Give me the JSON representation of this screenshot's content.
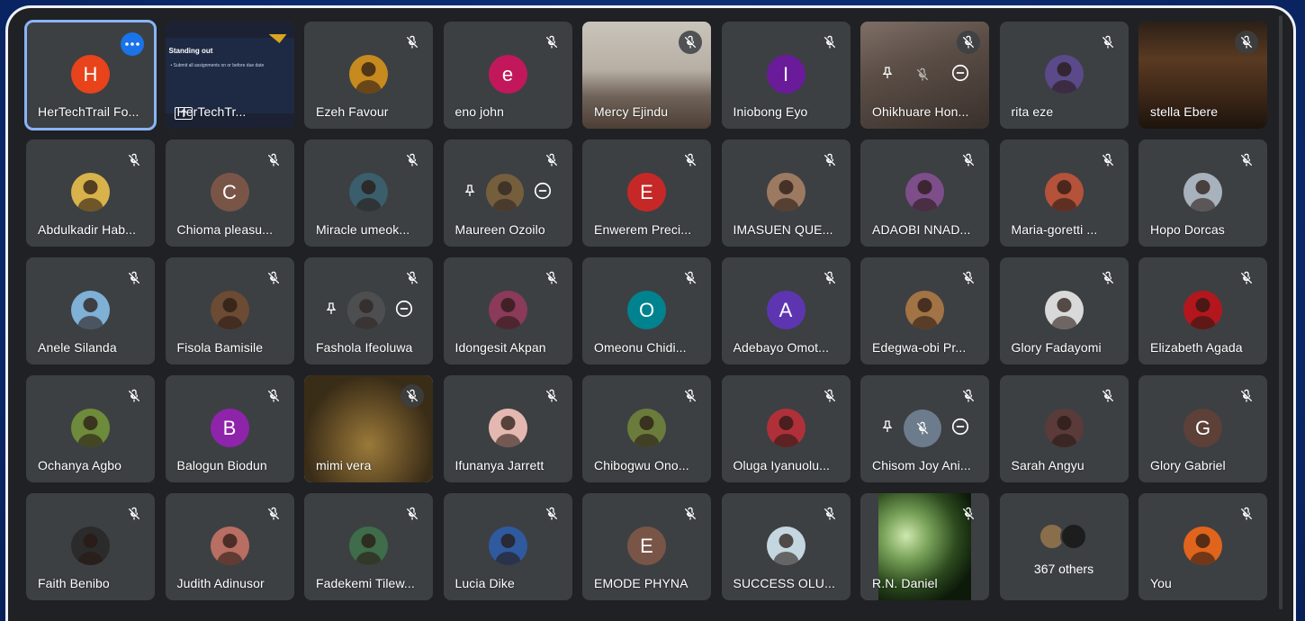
{
  "participants": [
    {
      "name": "HerTechTrail Fo...",
      "avatar": "letter",
      "letter": "H",
      "color": "#e8431b",
      "active": true,
      "control": "more"
    },
    {
      "name": "HerTechTr...",
      "avatar": "slide",
      "slide_title": "Standing out",
      "slide_bullet": "• Submit all assignments on or before due date",
      "control": "present"
    },
    {
      "name": "Ezeh Favour",
      "avatar": "photo",
      "color": "#c78a1e"
    },
    {
      "name": "eno john",
      "avatar": "letter",
      "letter": "e",
      "color": "#c2185b"
    },
    {
      "name": "Mercy Ejindu",
      "avatar": "video",
      "video": "vid-mercy"
    },
    {
      "name": "Iniobong Eyo",
      "avatar": "letter",
      "letter": "I",
      "color": "#6a1b9a"
    },
    {
      "name": "Ohikhuare Hon...",
      "avatar": "video-pinned",
      "video": "vid-ohik"
    },
    {
      "name": "rita eze",
      "avatar": "photo",
      "color": "#5a4a8a"
    },
    {
      "name": "stella Ebere",
      "avatar": "video",
      "video": "vid-stella"
    },
    {
      "name": "Abdulkadir Hab...",
      "avatar": "photo",
      "color": "#d8b24a"
    },
    {
      "name": "Chioma pleasu...",
      "avatar": "letter",
      "letter": "C",
      "color": "#795548"
    },
    {
      "name": "Miracle umeok...",
      "avatar": "photo",
      "color": "#3b5e6c"
    },
    {
      "name": "Maureen Ozoilo",
      "avatar": "pinned",
      "color": "#8e6b3a"
    },
    {
      "name": "Enwerem Preci...",
      "avatar": "letter",
      "letter": "E",
      "color": "#c62828"
    },
    {
      "name": "IMASUEN QUE...",
      "avatar": "photo",
      "color": "#9c7a62"
    },
    {
      "name": "ADAOBI NNAD...",
      "avatar": "photo",
      "color": "#7d4e8a"
    },
    {
      "name": "Maria-goretti ...",
      "avatar": "photo",
      "color": "#b5523a"
    },
    {
      "name": "Hopo Dorcas",
      "avatar": "photo",
      "color": "#a7b2bc"
    },
    {
      "name": "Anele Silanda",
      "avatar": "photo",
      "color": "#7fb0d6"
    },
    {
      "name": "Fisola Bamisile",
      "avatar": "photo",
      "color": "#6b4b33"
    },
    {
      "name": "Fashola Ifeoluwa",
      "avatar": "pinned",
      "color": "#555"
    },
    {
      "name": "Idongesit Akpan",
      "avatar": "photo",
      "color": "#8b3a5a"
    },
    {
      "name": "Omeonu Chidi...",
      "avatar": "letter",
      "letter": "O",
      "color": "#00838f"
    },
    {
      "name": "Adebayo Omot...",
      "avatar": "letter",
      "letter": "A",
      "color": "#5e35b1"
    },
    {
      "name": "Edegwa-obi Pr...",
      "avatar": "photo",
      "color": "#a27344"
    },
    {
      "name": "Glory Fadayomi",
      "avatar": "photo",
      "color": "#d9d9d9"
    },
    {
      "name": "Elizabeth Agada",
      "avatar": "photo",
      "color": "#b3171d"
    },
    {
      "name": "Ochanya Agbo",
      "avatar": "photo",
      "color": "#6d8b3a"
    },
    {
      "name": "Balogun Biodun",
      "avatar": "letter",
      "letter": "B",
      "color": "#8e24aa"
    },
    {
      "name": "mimi vera",
      "avatar": "video",
      "video": "vid-mimi"
    },
    {
      "name": "Ifunanya Jarrett",
      "avatar": "photo",
      "color": "#e4b8b0"
    },
    {
      "name": "Chibogwu Ono...",
      "avatar": "photo",
      "color": "#6a7b3c"
    },
    {
      "name": "Oluga Iyanuolu...",
      "avatar": "photo",
      "color": "#b0303a"
    },
    {
      "name": "Chisom Joy Ani...",
      "avatar": "pinned-muted",
      "color": "#6c7c8c"
    },
    {
      "name": "Sarah Angyu",
      "avatar": "photo",
      "color": "#5b3a3a"
    },
    {
      "name": "Glory Gabriel",
      "avatar": "letter",
      "letter": "G",
      "color": "#5d4037"
    },
    {
      "name": "Faith Benibo",
      "avatar": "photo",
      "color": "#2b2b2b"
    },
    {
      "name": "Judith Adinusor",
      "avatar": "photo",
      "color": "#b86e62"
    },
    {
      "name": "Fadekemi Tilew...",
      "avatar": "photo",
      "color": "#3f6c4a"
    },
    {
      "name": "Lucia Dike",
      "avatar": "photo",
      "color": "#2f5aa0"
    },
    {
      "name": "EMODE PHYNA",
      "avatar": "letter",
      "letter": "E",
      "color": "#795548"
    },
    {
      "name": "SUCCESS OLU...",
      "avatar": "photo",
      "color": "#c4d6e0"
    },
    {
      "name": "R.N. Daniel",
      "avatar": "video-narrow",
      "video": "vid-daniel"
    },
    {
      "name": "",
      "avatar": "others",
      "others_label": "367 others"
    },
    {
      "name": "You",
      "avatar": "photo",
      "color": "#e0641c"
    }
  ],
  "colors": {
    "tile_bg": "#3c4043",
    "frame_bg": "#202124",
    "active_outline": "#8ab4f8",
    "more_button": "#1a73e8"
  },
  "icons": {
    "mic_off": "mic-off-icon",
    "pin": "pin-icon",
    "remove": "remove-icon",
    "more": "more-options-icon",
    "present": "presenting-icon"
  }
}
